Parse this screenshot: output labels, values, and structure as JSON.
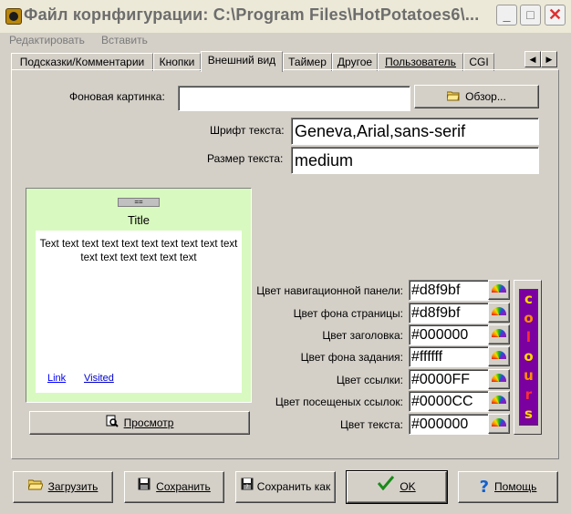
{
  "window": {
    "title": "Файл корнфигурации: C:\\Program Files\\HotPotatoes6\\...",
    "minimize": "_",
    "maximize": "□",
    "close": "✕"
  },
  "menu": {
    "edit": "Редактировать",
    "insert": "Вставить"
  },
  "tabs": [
    {
      "label": "Подсказки/Комментарии"
    },
    {
      "label": "Кнопки"
    },
    {
      "label": "Внешний вид"
    },
    {
      "label": "Таймер"
    },
    {
      "label": "Другое"
    },
    {
      "label": "Пользователь"
    },
    {
      "label": "CGI"
    }
  ],
  "tab_arrows": {
    "left": "◀",
    "right": "▶"
  },
  "appearance": {
    "background_image_label": "Фоновая картинка:",
    "background_image_value": "",
    "browse_button": "Обзор...",
    "font_label": "Шрифт текста:",
    "font_value": "Geneva,Arial,sans-serif",
    "size_label": "Размер текста:",
    "size_value": "medium"
  },
  "preview": {
    "bar": "==",
    "title": "Title",
    "text": "Text text text text text text text text text text text text text text text text",
    "link": "Link",
    "visited": "Visited",
    "preview_button": "Просмотр"
  },
  "colors": [
    {
      "label": "Цвет навигационной панели:",
      "value": "#d8f9bf"
    },
    {
      "label": "Цвет фона страницы:",
      "value": "#d8f9bf"
    },
    {
      "label": "Цвет заголовка:",
      "value": "#000000"
    },
    {
      "label": "Цвет фона задания:",
      "value": "#ffffff"
    },
    {
      "label": "Цвет ссылки:",
      "value": "#0000FF"
    },
    {
      "label": "Цвет посещеных ссылок:",
      "value": "#0000CC"
    },
    {
      "label": "Цвет текста:",
      "value": "#000000"
    }
  ],
  "colours_panel": {
    "letters": [
      "c",
      "o",
      "l",
      "o",
      "u",
      "r",
      "s"
    ],
    "letter_colors": [
      "#ffd700",
      "#ff8c00",
      "#ff3030",
      "#ffd700",
      "#ff8c00",
      "#ff3030",
      "#ffd700"
    ]
  },
  "buttons": {
    "load": "Загрузить",
    "save": "Сохранить",
    "save_as": "Сохранить как",
    "ok": "OK",
    "help": "Помощь"
  },
  "accent": {
    "preview_bg": "#d8f9bf",
    "link": "#0000FF",
    "visited": "#0000CC"
  }
}
